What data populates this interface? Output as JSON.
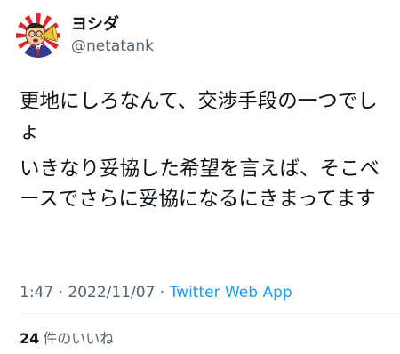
{
  "author": {
    "display_name": "ヨシダ",
    "handle": "@netatank",
    "avatar_icon": "cartoon-man-megaphone-avatar"
  },
  "tweet": {
    "paragraphs": [
      "更地にしろなんて、交渉手段の一つでしょ",
      "いきなり妥協した希望を言えば、そこベースでさらに妥協になるにきまってます"
    ]
  },
  "meta": {
    "time": "1:47",
    "separator_1": "·",
    "date": "2022/11/07",
    "separator_2": "·",
    "source": "Twitter Web App"
  },
  "likes": {
    "count": "24",
    "label": "件のいいね"
  },
  "colors": {
    "text": "#0f1419",
    "secondary": "#536471",
    "link": "#1d9bf0",
    "divider": "#eff3f4"
  }
}
